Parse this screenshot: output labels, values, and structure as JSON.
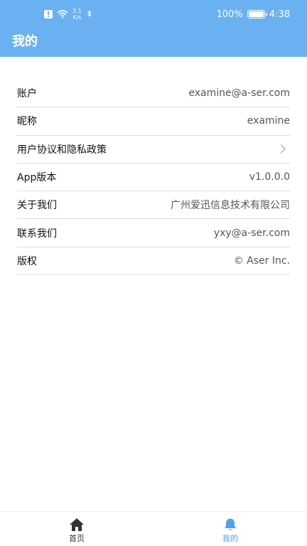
{
  "status_bar": {
    "net_speed_value": "3.1",
    "net_speed_unit": "K/s",
    "battery": "100%",
    "battery_level": 1.0,
    "time": "4:38",
    "icons": [
      "alert-icon",
      "wifi-icon",
      "usb-icon",
      "battery-icon"
    ]
  },
  "header": {
    "title": "我的"
  },
  "settings": {
    "items": [
      {
        "label": "账户",
        "value": "examine@a-ser.com"
      },
      {
        "label": "昵称",
        "value": "examine"
      },
      {
        "label": "用户协议和隐私政策",
        "icon": "chevron-right-icon"
      },
      {
        "label": "App版本",
        "value": "v1.0.0.0"
      },
      {
        "label": "关于我们",
        "value": "广州爱迅信息技术有限公司"
      },
      {
        "label": "联系我们",
        "value": "yxy@a-ser.com"
      },
      {
        "label": "版权",
        "value": "© Aser Inc."
      }
    ]
  },
  "bottom_nav": {
    "items": [
      {
        "label": "首页",
        "icon": "home-icon",
        "active": false
      },
      {
        "label": "我的",
        "icon": "bell-icon",
        "active": true
      }
    ]
  },
  "colors": {
    "header_bg": "#6ab1f2",
    "active_tab": "#4fa3ef",
    "divider": "#dcdcdc"
  }
}
